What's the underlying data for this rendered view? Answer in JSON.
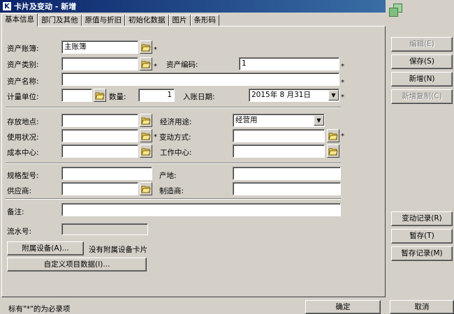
{
  "window": {
    "title": "卡片及变动 - 新增",
    "title_icon_glyph": "K"
  },
  "tabs": [
    "基本信息",
    "部门及其他",
    "原值与折旧",
    "初始化数据",
    "图片",
    "条形码"
  ],
  "required_mark": "*",
  "form": {
    "account_book": {
      "label": "资产账簿:",
      "value": "主账簿"
    },
    "asset_category": {
      "label": "资产类别:",
      "value": ""
    },
    "asset_code": {
      "label": "资产编码:",
      "value": "1"
    },
    "asset_name": {
      "label": "资产名称:",
      "value": ""
    },
    "unit": {
      "label": "计量单位:",
      "value": ""
    },
    "quantity": {
      "label": "数量:",
      "value": "1"
    },
    "entry_date": {
      "label": "入账日期:",
      "value": "2015年 8 月31日"
    },
    "location": {
      "label": "存放地点:",
      "value": ""
    },
    "economic_use": {
      "label": "经济用途:",
      "value": "经营用"
    },
    "usage_status": {
      "label": "使用状况:",
      "value": ""
    },
    "change_method": {
      "label": "变动方式:",
      "value": ""
    },
    "cost_center": {
      "label": "成本中心:",
      "value": ""
    },
    "work_center": {
      "label": "工作中心:",
      "value": ""
    },
    "spec_model": {
      "label": "规格型号:",
      "value": ""
    },
    "origin": {
      "label": "产地:",
      "value": ""
    },
    "supplier": {
      "label": "供应商:",
      "value": ""
    },
    "manufacturer": {
      "label": "制造商:",
      "value": ""
    },
    "remarks": {
      "label": "备注:",
      "value": ""
    },
    "serial_no": {
      "label": "流水号:",
      "value": ""
    }
  },
  "buttons": {
    "attached_equipment": "附属设备(A)...",
    "attached_note": "没有附属设备卡片",
    "custom_data": "自定义项目数据(I)...",
    "edit": "编辑(E)",
    "save": "保存(S)",
    "add": "新增(N)",
    "add_copy": "新增复制(C)",
    "change_record": "变动记录(R)",
    "temp_save": "暂存(T)",
    "temp_record": "暂存记录(M)",
    "ok": "确定",
    "cancel": "取消"
  },
  "status": {
    "note": "标有\"*\"的为必录项"
  }
}
